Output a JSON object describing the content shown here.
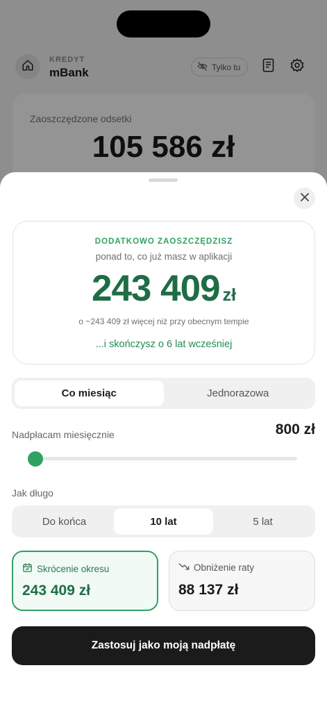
{
  "background": {
    "kicker": "KREDYT",
    "bank_name": "mBank",
    "only_you_label": "Tylko tu",
    "card_label": "Zaoszczędzone odsetki",
    "card_value": "105 586 zł"
  },
  "sheet": {
    "hero": {
      "kicker": "DODATKOWO ZAOSZCZĘDZISZ",
      "subtitle": "ponad to, co już masz w aplikacji",
      "value": "243 409",
      "currency": "zł",
      "compare": "o ~243 409 zł więcej niż przy obecnym tempie",
      "earlier": "...i skończysz o 6 lat wcześniej"
    },
    "frequency_tabs": [
      {
        "label": "Co miesiąc",
        "active": true
      },
      {
        "label": "Jednorazowa",
        "active": false
      }
    ],
    "payment_label": "Nadpłacam miesięcznie",
    "payment_value": "800 zł",
    "slider_fraction": 0.0,
    "duration_label": "Jak długo",
    "duration_tabs": [
      {
        "label": "Do końca",
        "active": false
      },
      {
        "label": "10 lat",
        "active": true
      },
      {
        "label": "5 lat",
        "active": false
      }
    ],
    "options": [
      {
        "title": "Skrócenie okresu",
        "value": "243 409 zł",
        "icon": "calendar-check-icon",
        "selected": true
      },
      {
        "title": "Obniżenie raty",
        "value": "88 137 zł",
        "icon": "trend-down-icon",
        "selected": false
      }
    ],
    "cta_label": "Zastosuj jako moją nadpłatę"
  },
  "colors": {
    "accent": "#2ea262",
    "accent_dark": "#1e6d45",
    "cta_background": "#1b1b1b"
  }
}
